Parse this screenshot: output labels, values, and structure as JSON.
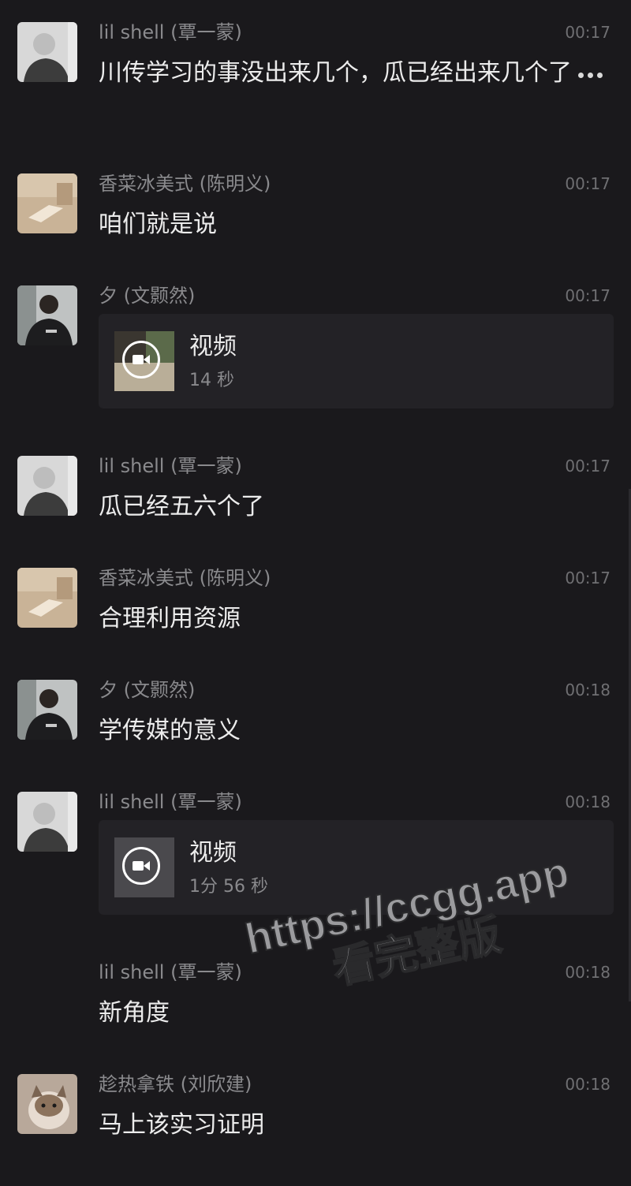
{
  "messages": [
    {
      "sender": "lil shell (覃一蒙)",
      "time": "00:17",
      "text": "川传学习的事没出来几个，瓜已经出来几个了"
    },
    {
      "sender": "香菜冰美式 (陈明义)",
      "time": "00:17",
      "text": "咱们就是说"
    },
    {
      "sender": "夕 (文颢然)",
      "time": "00:17",
      "video": {
        "title": "视频",
        "duration": "14 秒"
      }
    },
    {
      "sender": "lil shell (覃一蒙)",
      "time": "00:17",
      "text": "瓜已经五六个了"
    },
    {
      "sender": "香菜冰美式 (陈明义)",
      "time": "00:17",
      "text": "合理利用资源"
    },
    {
      "sender": "夕 (文颢然)",
      "time": "00:18",
      "text": "学传媒的意义"
    },
    {
      "sender": "lil shell (覃一蒙)",
      "time": "00:18",
      "video": {
        "title": "视频",
        "duration": "1分 56 秒"
      }
    },
    {
      "sender": "lil shell (覃一蒙)",
      "time": "00:18",
      "text": "新角度"
    },
    {
      "sender": "趁热拿铁 (刘欣建)",
      "time": "00:18",
      "text": "马上该实习证明"
    }
  ],
  "watermark": {
    "line1": "https://ccgg.app",
    "line2": "看完整版"
  },
  "icons": {
    "more": "more-dots-icon",
    "play": "video-play-icon"
  }
}
